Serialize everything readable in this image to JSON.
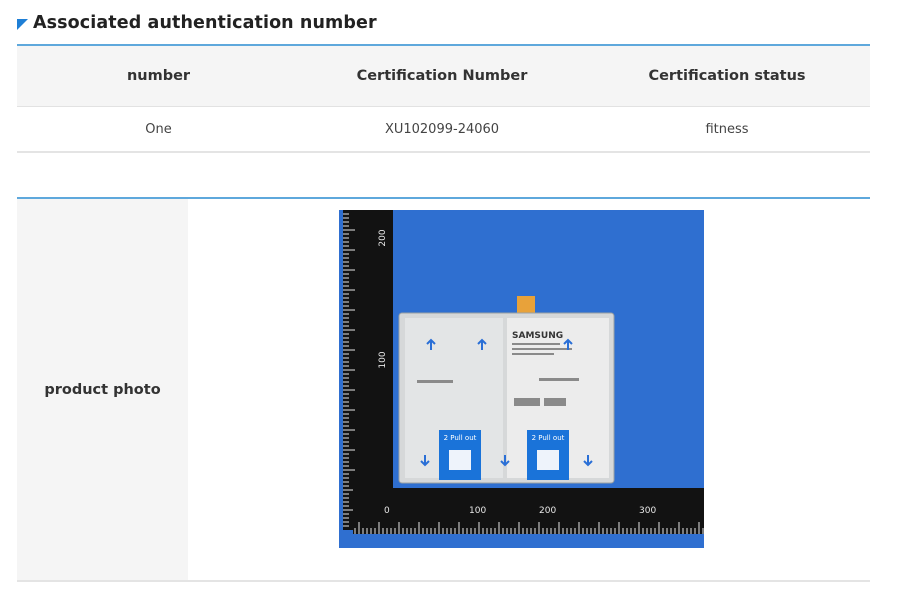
{
  "section": {
    "title": "Associated authentication number"
  },
  "cert_table": {
    "headers": [
      "number",
      "Certification Number",
      "Certification status"
    ],
    "rows": [
      [
        "One",
        "XU102099-24060",
        "fitness"
      ]
    ]
  },
  "product": {
    "label": "product photo",
    "photo": {
      "brand_text": "SAMSUNG",
      "sticker_text": "2 Pull out",
      "ruler_marks_top": [
        "200",
        "100",
        "0"
      ],
      "ruler_marks_bottom": [
        "0",
        "100",
        "200",
        "300"
      ],
      "colors": {
        "background": "#2f6fd0",
        "battery": "#d6d8d9",
        "tab": "#e8a23a",
        "sticker": "#1a73d9"
      }
    }
  }
}
